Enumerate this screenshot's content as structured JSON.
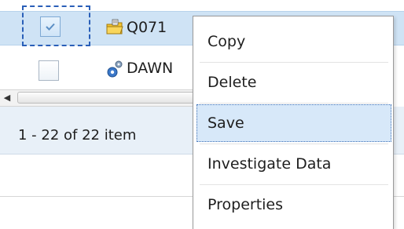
{
  "grid": {
    "rows": [
      {
        "name": "Q071",
        "icon": "folder-edit-icon",
        "selected": true,
        "checked": true
      },
      {
        "name": "DAWN",
        "icon": "gear-settings-icon",
        "selected": false,
        "checked": false
      }
    ],
    "pager_text": "1 - 22 of 22 item"
  },
  "scrollbar": {
    "left_arrow": "◀"
  },
  "context_menu": {
    "items": [
      {
        "label": "Copy"
      },
      {
        "label": "Delete"
      },
      {
        "label": "Save",
        "hovered": true
      },
      {
        "label": "Investigate Data"
      },
      {
        "label": "Properties"
      }
    ]
  },
  "colors": {
    "selected_row": "#cfe3f5",
    "menu_hover": "#d7e8f9",
    "focus_border": "#2a5fb8",
    "pager_bg": "#e8f0f8"
  }
}
